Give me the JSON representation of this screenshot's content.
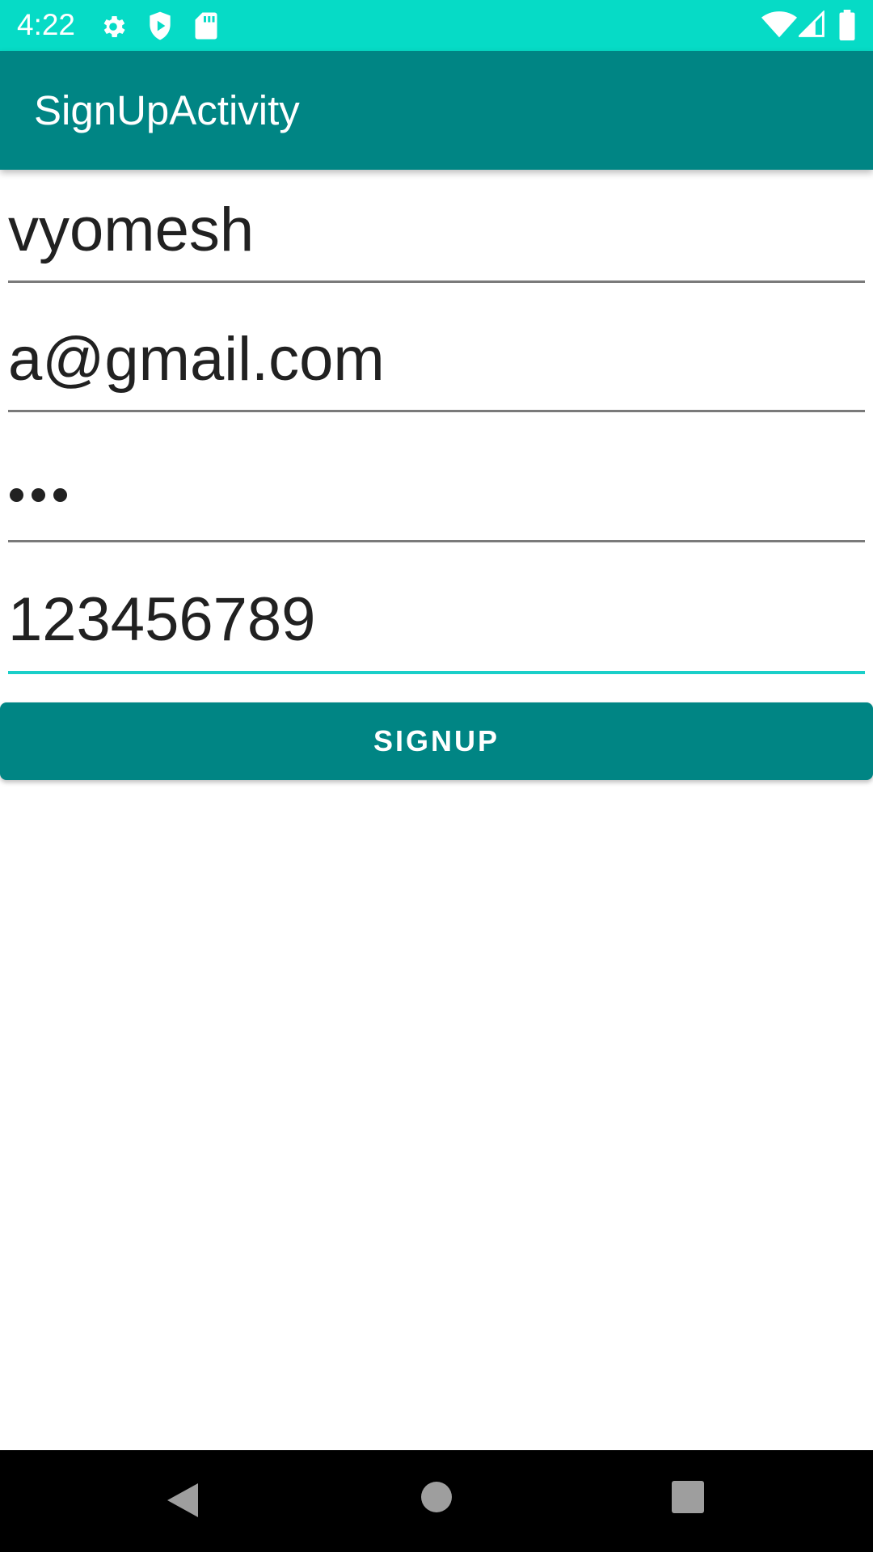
{
  "status_bar": {
    "time": "4:22",
    "background_color": "#06dbc6",
    "icons": [
      "gear-icon",
      "play-protect-icon",
      "sd-card-icon",
      "wifi-icon",
      "signal-icon",
      "battery-icon"
    ]
  },
  "app_bar": {
    "title": "SignUpActivity",
    "background_color": "#008584"
  },
  "form": {
    "username_value": "vyomesh",
    "email_value": "a@gmail.com",
    "password_masked": "•••",
    "phone_value": "123456789",
    "focused_field": "phone",
    "accent_color": "#1bcfc9"
  },
  "signup_button": {
    "label": "SIGNUP",
    "color": "#008584"
  },
  "nav_bar": {
    "icons": [
      "back-icon",
      "home-icon",
      "recents-icon"
    ]
  }
}
